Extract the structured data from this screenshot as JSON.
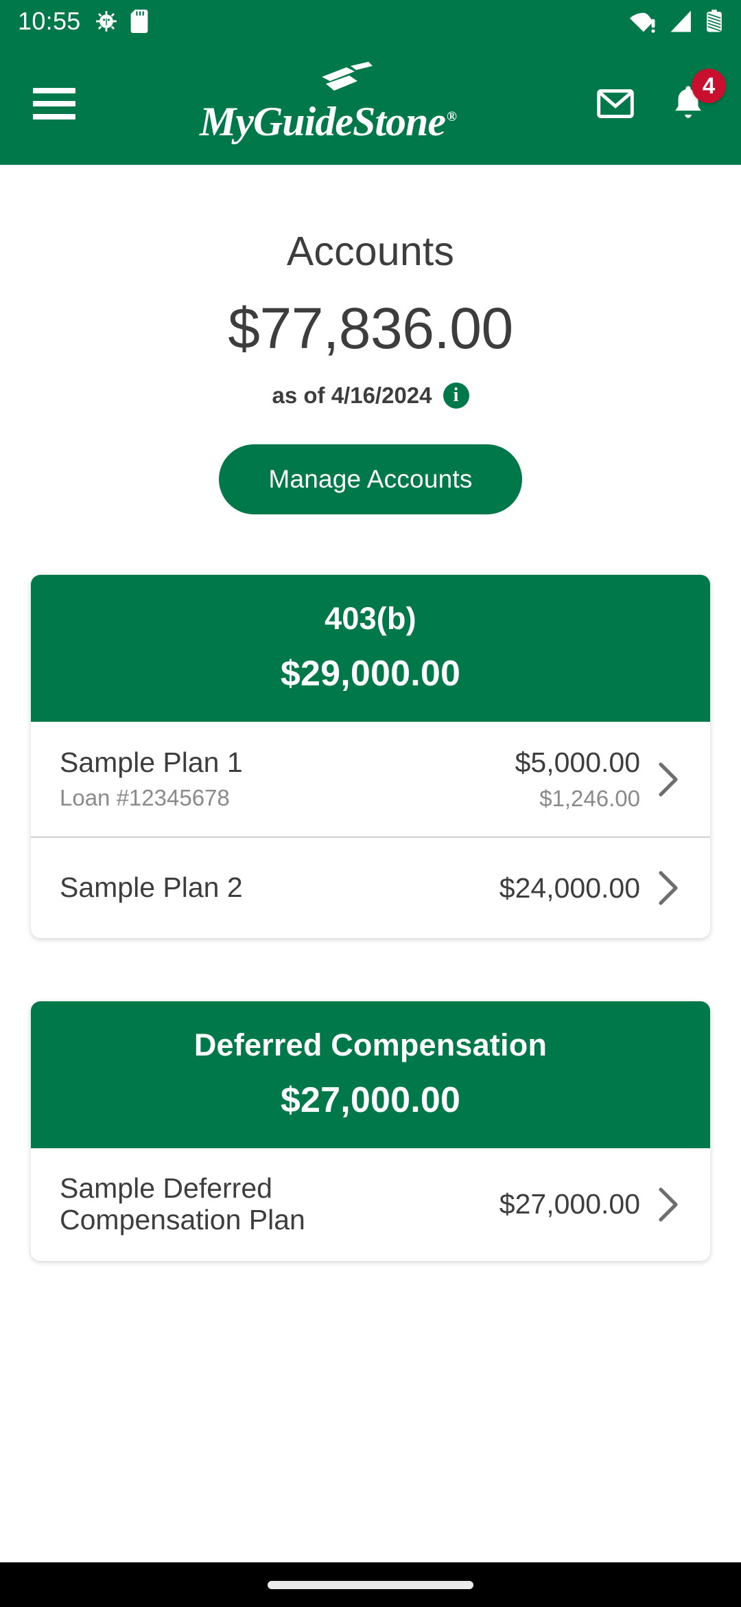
{
  "status_bar": {
    "time": "10:55",
    "left_icons": [
      "android-debug-icon",
      "sd-card-icon"
    ],
    "right_icons": [
      "wifi-warning-icon",
      "cellular-signal-icon",
      "battery-icon"
    ]
  },
  "app_bar": {
    "menu_icon": "hamburger-menu-icon",
    "brand_name": "MyGuideStone",
    "brand_registered_mark": "®",
    "brand_logo_icon": "guidestone-stones-logo",
    "mail_icon": "mail-icon",
    "bell_icon": "bell-icon",
    "notification_count": "4",
    "badge_color": "#C8102E"
  },
  "theme": {
    "brand_green": "#00784A",
    "text_dark": "#3d3d3d",
    "text_muted": "#8a8a8a",
    "page_background": "#ffffff"
  },
  "summary": {
    "title": "Accounts",
    "total_balance": "$77,836.00",
    "as_of_label": "as of 4/16/2024",
    "info_icon": "info-icon",
    "info_glyph": "i"
  },
  "actions": {
    "manage_accounts_label": "Manage Accounts"
  },
  "account_groups": [
    {
      "title": "403(b)",
      "amount": "$29,000.00",
      "plans": [
        {
          "name": "Sample Plan 1",
          "sub": "Loan #12345678",
          "amount": "$5,000.00",
          "sub_amount": "$1,246.00",
          "chevron": "chevron-right-icon"
        },
        {
          "name": "Sample Plan 2",
          "sub": "",
          "amount": "$24,000.00",
          "sub_amount": "",
          "chevron": "chevron-right-icon"
        }
      ]
    },
    {
      "title": "Deferred Compensation",
      "amount": "$27,000.00",
      "plans": [
        {
          "name": "Sample Deferred Compensation Plan",
          "sub": "",
          "amount": "$27,000.00",
          "sub_amount": "",
          "chevron": "chevron-right-icon"
        }
      ]
    }
  ],
  "system_nav": {
    "home_indicator": "home-indicator-pill"
  }
}
